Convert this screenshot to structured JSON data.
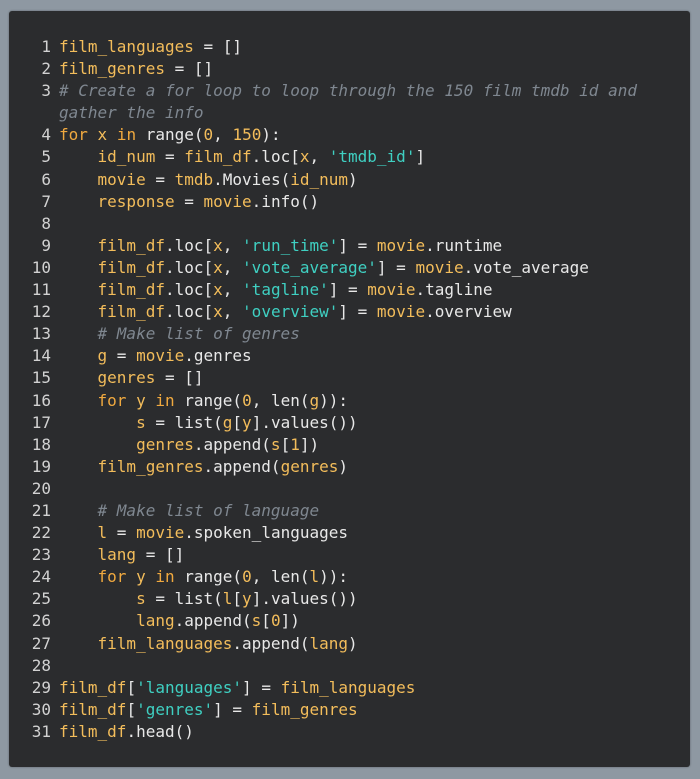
{
  "colors": {
    "background": "#8e98a2",
    "panel": "#2b2c2e",
    "identifier": "#f3bd5b",
    "keyword": "#f0a93f",
    "string": "#3fd0c2",
    "comment": "#7f8790",
    "text": "#e8e8e8"
  },
  "code_lines": [
    {
      "n": "1",
      "tokens": [
        [
          "var",
          "film_languages"
        ],
        [
          "plain",
          " = []"
        ]
      ]
    },
    {
      "n": "2",
      "tokens": [
        [
          "var",
          "film_genres"
        ],
        [
          "plain",
          " = []"
        ]
      ]
    },
    {
      "n": "3",
      "tokens": [
        [
          "com",
          "# Create a for loop to loop through the 150 film tmdb id and gather the info"
        ]
      ],
      "wrap": true
    },
    {
      "n": "4",
      "tokens": [
        [
          "kw",
          "for"
        ],
        [
          "plain",
          " "
        ],
        [
          "var",
          "x"
        ],
        [
          "plain",
          " "
        ],
        [
          "kw",
          "in"
        ],
        [
          "plain",
          " range("
        ],
        [
          "num",
          "0"
        ],
        [
          "plain",
          ", "
        ],
        [
          "num",
          "150"
        ],
        [
          "plain",
          "):"
        ]
      ]
    },
    {
      "n": "5",
      "tokens": [
        [
          "plain",
          "    "
        ],
        [
          "var",
          "id_num"
        ],
        [
          "plain",
          " = "
        ],
        [
          "var",
          "film_df"
        ],
        [
          "plain",
          ".loc["
        ],
        [
          "var",
          "x"
        ],
        [
          "plain",
          ", "
        ],
        [
          "str",
          "'tmdb_id'"
        ],
        [
          "plain",
          "]"
        ]
      ]
    },
    {
      "n": "6",
      "tokens": [
        [
          "plain",
          "    "
        ],
        [
          "var",
          "movie"
        ],
        [
          "plain",
          " = "
        ],
        [
          "var",
          "tmdb"
        ],
        [
          "plain",
          ".Movies("
        ],
        [
          "var",
          "id_num"
        ],
        [
          "plain",
          ")"
        ]
      ]
    },
    {
      "n": "7",
      "tokens": [
        [
          "plain",
          "    "
        ],
        [
          "var",
          "response"
        ],
        [
          "plain",
          " = "
        ],
        [
          "var",
          "movie"
        ],
        [
          "plain",
          ".info()"
        ]
      ]
    },
    {
      "n": "8",
      "tokens": []
    },
    {
      "n": "9",
      "tokens": [
        [
          "plain",
          "    "
        ],
        [
          "var",
          "film_df"
        ],
        [
          "plain",
          ".loc["
        ],
        [
          "var",
          "x"
        ],
        [
          "plain",
          ", "
        ],
        [
          "str",
          "'run_time'"
        ],
        [
          "plain",
          "] = "
        ],
        [
          "var",
          "movie"
        ],
        [
          "plain",
          ".runtime"
        ]
      ]
    },
    {
      "n": "10",
      "tokens": [
        [
          "plain",
          "    "
        ],
        [
          "var",
          "film_df"
        ],
        [
          "plain",
          ".loc["
        ],
        [
          "var",
          "x"
        ],
        [
          "plain",
          ", "
        ],
        [
          "str",
          "'vote_average'"
        ],
        [
          "plain",
          "] = "
        ],
        [
          "var",
          "movie"
        ],
        [
          "plain",
          ".vote_average"
        ]
      ]
    },
    {
      "n": "11",
      "tokens": [
        [
          "plain",
          "    "
        ],
        [
          "var",
          "film_df"
        ],
        [
          "plain",
          ".loc["
        ],
        [
          "var",
          "x"
        ],
        [
          "plain",
          ", "
        ],
        [
          "str",
          "'tagline'"
        ],
        [
          "plain",
          "] = "
        ],
        [
          "var",
          "movie"
        ],
        [
          "plain",
          ".tagline"
        ]
      ]
    },
    {
      "n": "12",
      "tokens": [
        [
          "plain",
          "    "
        ],
        [
          "var",
          "film_df"
        ],
        [
          "plain",
          ".loc["
        ],
        [
          "var",
          "x"
        ],
        [
          "plain",
          ", "
        ],
        [
          "str",
          "'overview'"
        ],
        [
          "plain",
          "] = "
        ],
        [
          "var",
          "movie"
        ],
        [
          "plain",
          ".overview"
        ]
      ]
    },
    {
      "n": "13",
      "tokens": [
        [
          "plain",
          "    "
        ],
        [
          "com",
          "# Make list of genres"
        ]
      ]
    },
    {
      "n": "14",
      "tokens": [
        [
          "plain",
          "    "
        ],
        [
          "var",
          "g"
        ],
        [
          "plain",
          " = "
        ],
        [
          "var",
          "movie"
        ],
        [
          "plain",
          ".genres"
        ]
      ]
    },
    {
      "n": "15",
      "tokens": [
        [
          "plain",
          "    "
        ],
        [
          "var",
          "genres"
        ],
        [
          "plain",
          " = []"
        ]
      ]
    },
    {
      "n": "16",
      "tokens": [
        [
          "plain",
          "    "
        ],
        [
          "kw",
          "for"
        ],
        [
          "plain",
          " "
        ],
        [
          "var",
          "y"
        ],
        [
          "plain",
          " "
        ],
        [
          "kw",
          "in"
        ],
        [
          "plain",
          " range("
        ],
        [
          "num",
          "0"
        ],
        [
          "plain",
          ", len("
        ],
        [
          "var",
          "g"
        ],
        [
          "plain",
          "))"
        ],
        [
          "plain",
          ":"
        ]
      ]
    },
    {
      "n": "17",
      "tokens": [
        [
          "plain",
          "        "
        ],
        [
          "var",
          "s"
        ],
        [
          "plain",
          " = list("
        ],
        [
          "var",
          "g"
        ],
        [
          "plain",
          "["
        ],
        [
          "var",
          "y"
        ],
        [
          "plain",
          "].values())"
        ]
      ]
    },
    {
      "n": "18",
      "tokens": [
        [
          "plain",
          "        "
        ],
        [
          "var",
          "genres"
        ],
        [
          "plain",
          ".append("
        ],
        [
          "var",
          "s"
        ],
        [
          "plain",
          "["
        ],
        [
          "num",
          "1"
        ],
        [
          "plain",
          "])"
        ]
      ]
    },
    {
      "n": "19",
      "tokens": [
        [
          "plain",
          "    "
        ],
        [
          "var",
          "film_genres"
        ],
        [
          "plain",
          ".append("
        ],
        [
          "var",
          "genres"
        ],
        [
          "plain",
          ")"
        ]
      ]
    },
    {
      "n": "20",
      "tokens": []
    },
    {
      "n": "21",
      "tokens": [
        [
          "plain",
          "    "
        ],
        [
          "com",
          "# Make list of language"
        ]
      ]
    },
    {
      "n": "22",
      "tokens": [
        [
          "plain",
          "    "
        ],
        [
          "var",
          "l"
        ],
        [
          "plain",
          " = "
        ],
        [
          "var",
          "movie"
        ],
        [
          "plain",
          ".spoken_languages"
        ]
      ]
    },
    {
      "n": "23",
      "tokens": [
        [
          "plain",
          "    "
        ],
        [
          "var",
          "lang"
        ],
        [
          "plain",
          " = []"
        ]
      ]
    },
    {
      "n": "24",
      "tokens": [
        [
          "plain",
          "    "
        ],
        [
          "kw",
          "for"
        ],
        [
          "plain",
          " "
        ],
        [
          "var",
          "y"
        ],
        [
          "plain",
          " "
        ],
        [
          "kw",
          "in"
        ],
        [
          "plain",
          " range("
        ],
        [
          "num",
          "0"
        ],
        [
          "plain",
          ", len("
        ],
        [
          "var",
          "l"
        ],
        [
          "plain",
          "))"
        ],
        [
          "plain",
          ":"
        ]
      ]
    },
    {
      "n": "25",
      "tokens": [
        [
          "plain",
          "        "
        ],
        [
          "var",
          "s"
        ],
        [
          "plain",
          " = list("
        ],
        [
          "var",
          "l"
        ],
        [
          "plain",
          "["
        ],
        [
          "var",
          "y"
        ],
        [
          "plain",
          "].values())"
        ]
      ]
    },
    {
      "n": "26",
      "tokens": [
        [
          "plain",
          "        "
        ],
        [
          "var",
          "lang"
        ],
        [
          "plain",
          ".append("
        ],
        [
          "var",
          "s"
        ],
        [
          "plain",
          "["
        ],
        [
          "num",
          "0"
        ],
        [
          "plain",
          "])"
        ]
      ]
    },
    {
      "n": "27",
      "tokens": [
        [
          "plain",
          "    "
        ],
        [
          "var",
          "film_languages"
        ],
        [
          "plain",
          ".append("
        ],
        [
          "var",
          "lang"
        ],
        [
          "plain",
          ")"
        ]
      ]
    },
    {
      "n": "28",
      "tokens": []
    },
    {
      "n": "29",
      "tokens": [
        [
          "var",
          "film_df"
        ],
        [
          "plain",
          "["
        ],
        [
          "str",
          "'languages'"
        ],
        [
          "plain",
          "] = "
        ],
        [
          "var",
          "film_languages"
        ]
      ]
    },
    {
      "n": "30",
      "tokens": [
        [
          "var",
          "film_df"
        ],
        [
          "plain",
          "["
        ],
        [
          "str",
          "'genres'"
        ],
        [
          "plain",
          "] = "
        ],
        [
          "var",
          "film_genres"
        ]
      ]
    },
    {
      "n": "31",
      "tokens": [
        [
          "var",
          "film_df"
        ],
        [
          "plain",
          ".head()"
        ]
      ]
    }
  ]
}
